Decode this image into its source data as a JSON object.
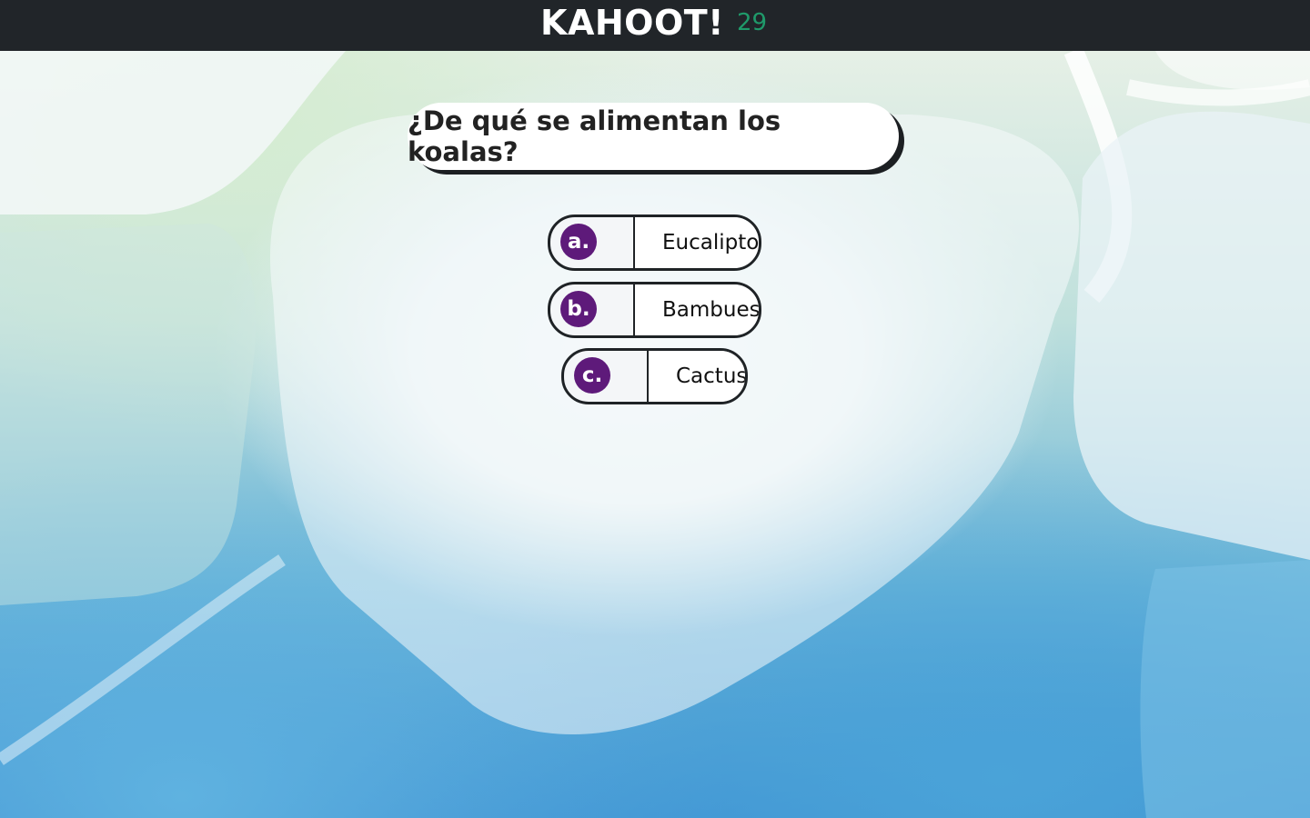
{
  "header": {
    "title": "KAHOOT!",
    "timer": "29"
  },
  "quiz": {
    "question": "¿De qué se alimentan los koalas?",
    "answers": [
      {
        "letter": "a.",
        "text": "Eucalipto"
      },
      {
        "letter": "b.",
        "text": "Bambues"
      },
      {
        "letter": "c.",
        "text": "Cactus"
      }
    ]
  },
  "colors": {
    "topbar": "#212529",
    "timer": "#1f9a6a",
    "badge": "#5e1a7a"
  }
}
